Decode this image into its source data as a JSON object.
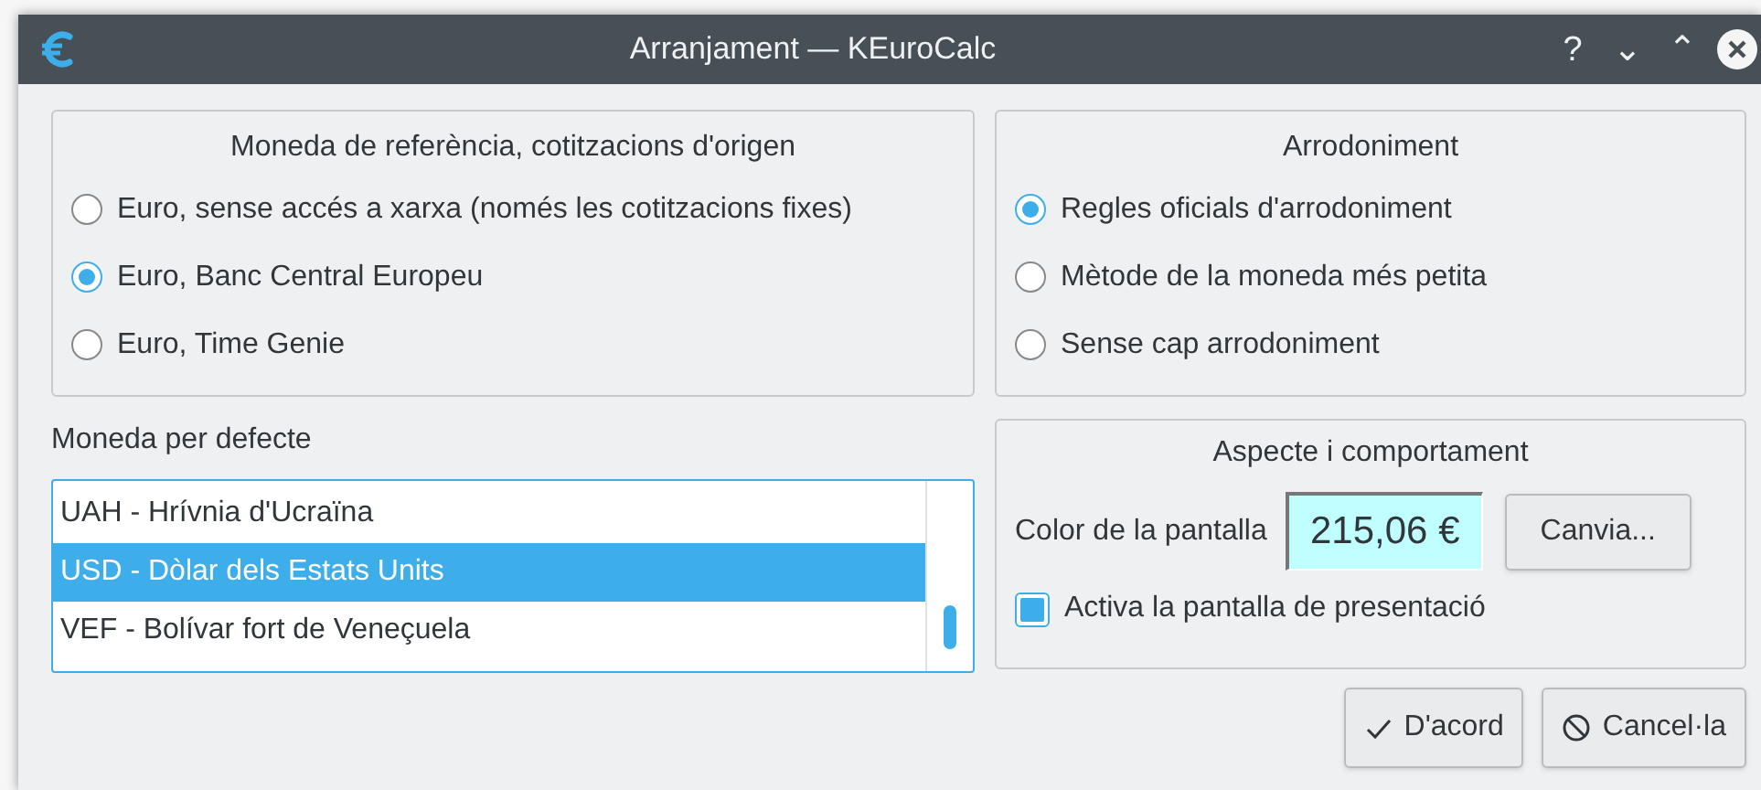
{
  "window": {
    "title": "Arranjament — KEuroCalc",
    "buttons": [
      "?",
      "⌄",
      "⌃"
    ]
  },
  "reference_currency": {
    "title": "Moneda de referència, cotitzacions d'origen",
    "options": [
      {
        "label": "Euro, sense accés a xarxa (només les cotitzacions fixes)",
        "selected": false
      },
      {
        "label": "Euro, Banc Central Europeu",
        "selected": true
      },
      {
        "label": "Euro, Time Genie",
        "selected": false
      }
    ]
  },
  "rounding": {
    "title": "Arrodoniment",
    "options": [
      {
        "label": "Regles oficials d'arrodoniment",
        "selected": true
      },
      {
        "label": "Mètode de la moneda més petita",
        "selected": false
      },
      {
        "label": "Sense cap arrodoniment",
        "selected": false
      }
    ]
  },
  "default_currency": {
    "label": "Moneda per defecte",
    "items": [
      {
        "label": "UAH - Hrívnia d'Ucraïna",
        "selected": false
      },
      {
        "label": "USD - Dòlar dels Estats Units",
        "selected": true
      },
      {
        "label": "VEF - Bolívar fort de Veneçuela",
        "selected": false
      }
    ]
  },
  "appearance": {
    "title": "Aspecte i comportament",
    "color_label": "Color de la pantalla",
    "preview": "215,06 €",
    "change_button": "Canvia...",
    "splash": {
      "label": "Activa la pantalla de presentació",
      "checked": true
    }
  },
  "actions": [
    {
      "label": "D'acord",
      "kind": "ok"
    },
    {
      "label": "Cancel·la",
      "kind": "cancel"
    }
  ]
}
